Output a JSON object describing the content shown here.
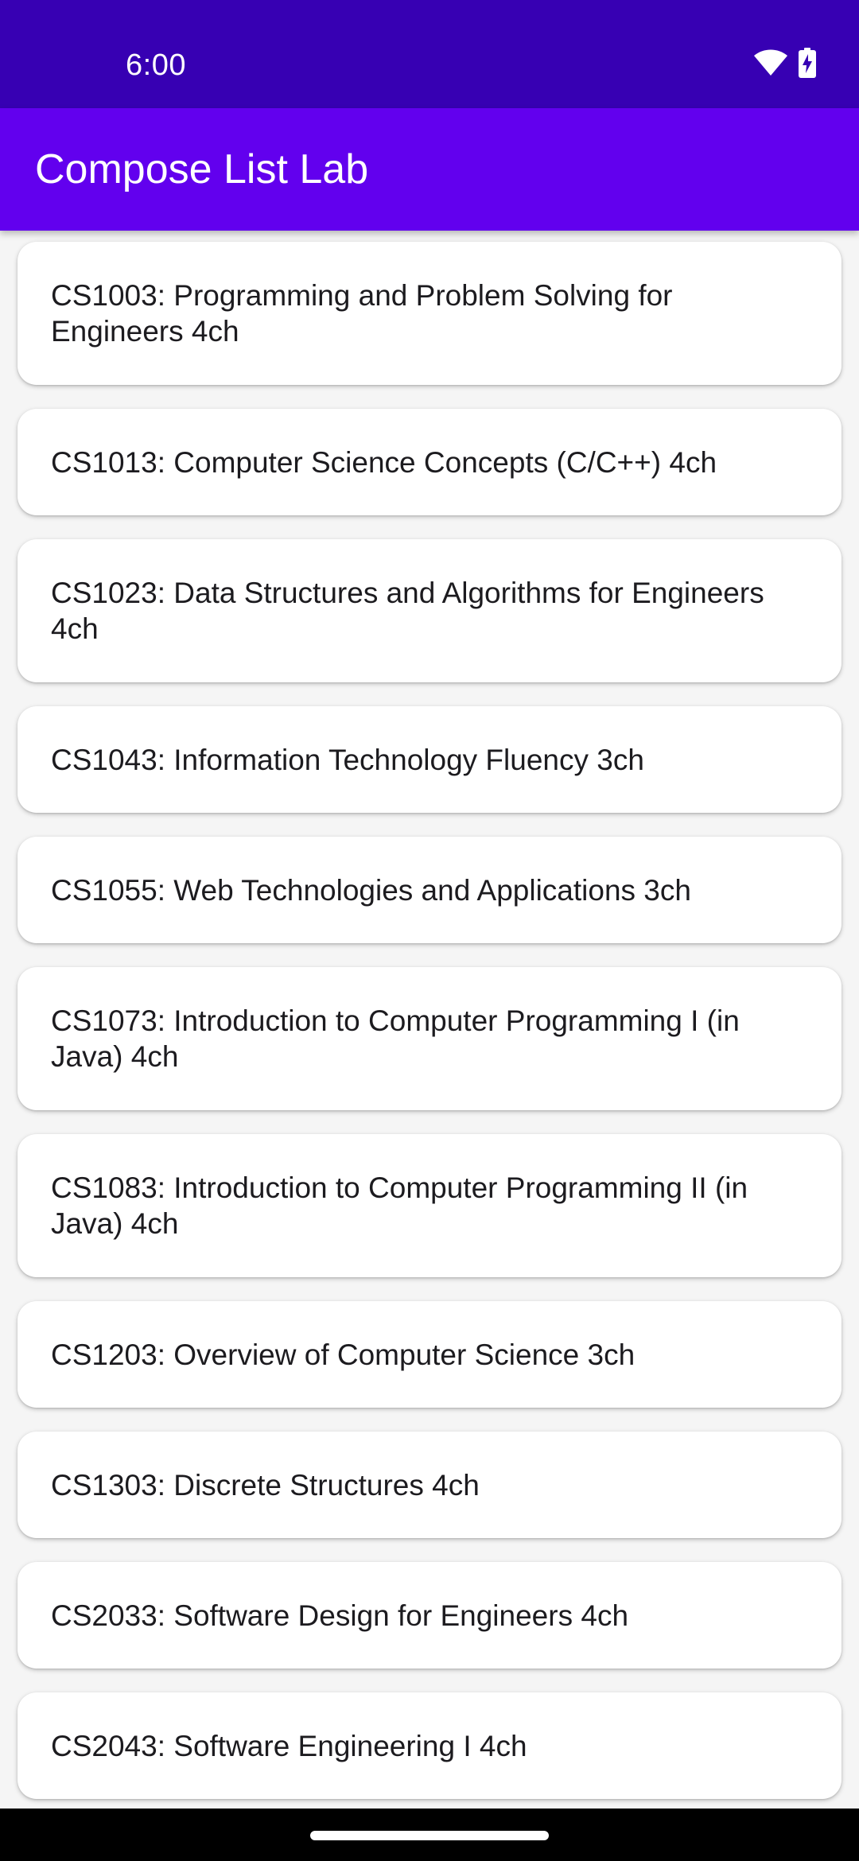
{
  "status_bar": {
    "time": "6:00",
    "icons": [
      "wifi-icon",
      "battery-charging-icon"
    ]
  },
  "app_bar": {
    "title": "Compose List Lab"
  },
  "courses": [
    "CS1003: Programming and Problem Solving for Engineers 4ch",
    "CS1013: Computer Science Concepts (C/C++) 4ch",
    "CS1023: Data Structures and Algorithms for Engineers 4ch",
    "CS1043: Information Technology Fluency 3ch",
    "CS1055: Web Technologies and Applications 3ch",
    "CS1073: Introduction to Computer Programming I (in Java) 4ch",
    "CS1083: Introduction to Computer Programming II (in Java) 4ch",
    "CS1203: Overview of Computer Science 3ch",
    "CS1303: Discrete Structures 4ch",
    "CS2033: Software Design for Engineers 4ch",
    "CS2043: Software Engineering I 4ch"
  ],
  "colors": {
    "status_bar": "#3700b3",
    "app_bar": "#6200ee",
    "background": "#f5f5f5",
    "card": "#ffffff"
  }
}
